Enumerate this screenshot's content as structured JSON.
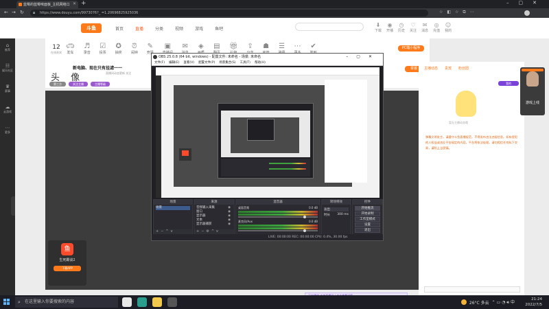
{
  "browser": {
    "tab_title": "蓝莓的蓝莓味面板_主机网络口",
    "url": "https://www.douyu.com/9973076?_ =1.20696825925036"
  },
  "site": {
    "logo": "斗鱼",
    "nav": [
      "首页",
      "直播",
      "分类",
      "视频",
      "游戏",
      "鱼吧"
    ],
    "header_icons": [
      "下载",
      "开播",
      "历史",
      "关注",
      "消息",
      "充值",
      "我的"
    ]
  },
  "sidebar": [
    "推荐",
    "娱乐社区",
    "赛事",
    "云游戏",
    "更多"
  ],
  "room": {
    "rank_num": "12",
    "rank_label": "在线贵宾",
    "tools": [
      "发车",
      "录音",
      "投票",
      "抽奖",
      "闹钟",
      "竞猜",
      "直播间",
      "消息",
      "画质",
      "翻页",
      "礼物",
      "分享",
      "房管",
      "弹幕",
      "更多",
      "签到",
      "充值",
      "设置",
      "排行"
    ],
    "follow_button": "PC端小程序",
    "title": "新电脑、现在只有挂滤一一",
    "subtitle": "直播间动态更新 关注",
    "name": "头 像",
    "tags": [
      "第三方",
      "关注主播",
      "主播等级"
    ],
    "report_button": "举报",
    "streamer_name": "生死霸谈2",
    "streamer_button": "下载APP"
  },
  "right_panel": {
    "tabs": [
      "主播动态",
      "贵宾",
      "粉丝团"
    ],
    "tag": "我的",
    "mascot_caption": "暂无主播动态哦",
    "notice": "弹幕文明发言，请遵守斗鱼直播规范，不得发布违法违规信息。如有侵犯他人权益或违反平台规定的内容，平台将依法处理。请勿相信任何私下交易，谨防上当受骗。"
  },
  "side_ad": {
    "text": "游戏上线"
  },
  "bottom_popup": "正在播放 大神直播间 | 点击查看详情",
  "obs": {
    "title": "OBS 25.0.8 (64 bit, windows) - 配置文件: 未命名 - 场景: 未命名",
    "menu": [
      "文件(F)",
      "编辑(E)",
      "查看(V)",
      "配置文件(P)",
      "场景集合(S)",
      "工具(T)",
      "帮助(H)"
    ],
    "docks": [
      "场景",
      "来源",
      "混音器",
      "转场特效",
      "控件"
    ],
    "scenes": [
      "场景"
    ],
    "sources": [
      "音频输入采集",
      "窗口",
      "显示器",
      "文本",
      "显示器捕获"
    ],
    "mixer": [
      {
        "name": "桌面音频",
        "level": "0.0 dB"
      },
      {
        "name": "麦克风/Aux",
        "level": "0.0 dB"
      }
    ],
    "transition": {
      "type": "淡出",
      "duration_label": "时长",
      "duration": "300 ms"
    },
    "controls": [
      "开始推流",
      "开始录制",
      "工作室模式",
      "设置",
      "退出"
    ],
    "status": "LIVE: 00:00:00   REC: 00:00:00   CPU: 0.4%, 30.00 fps"
  },
  "taskbar": {
    "search_placeholder": "在这里输入你要搜索的内容",
    "weather": "26°C 多云",
    "time": "21:24",
    "date": "2022/7/5"
  }
}
